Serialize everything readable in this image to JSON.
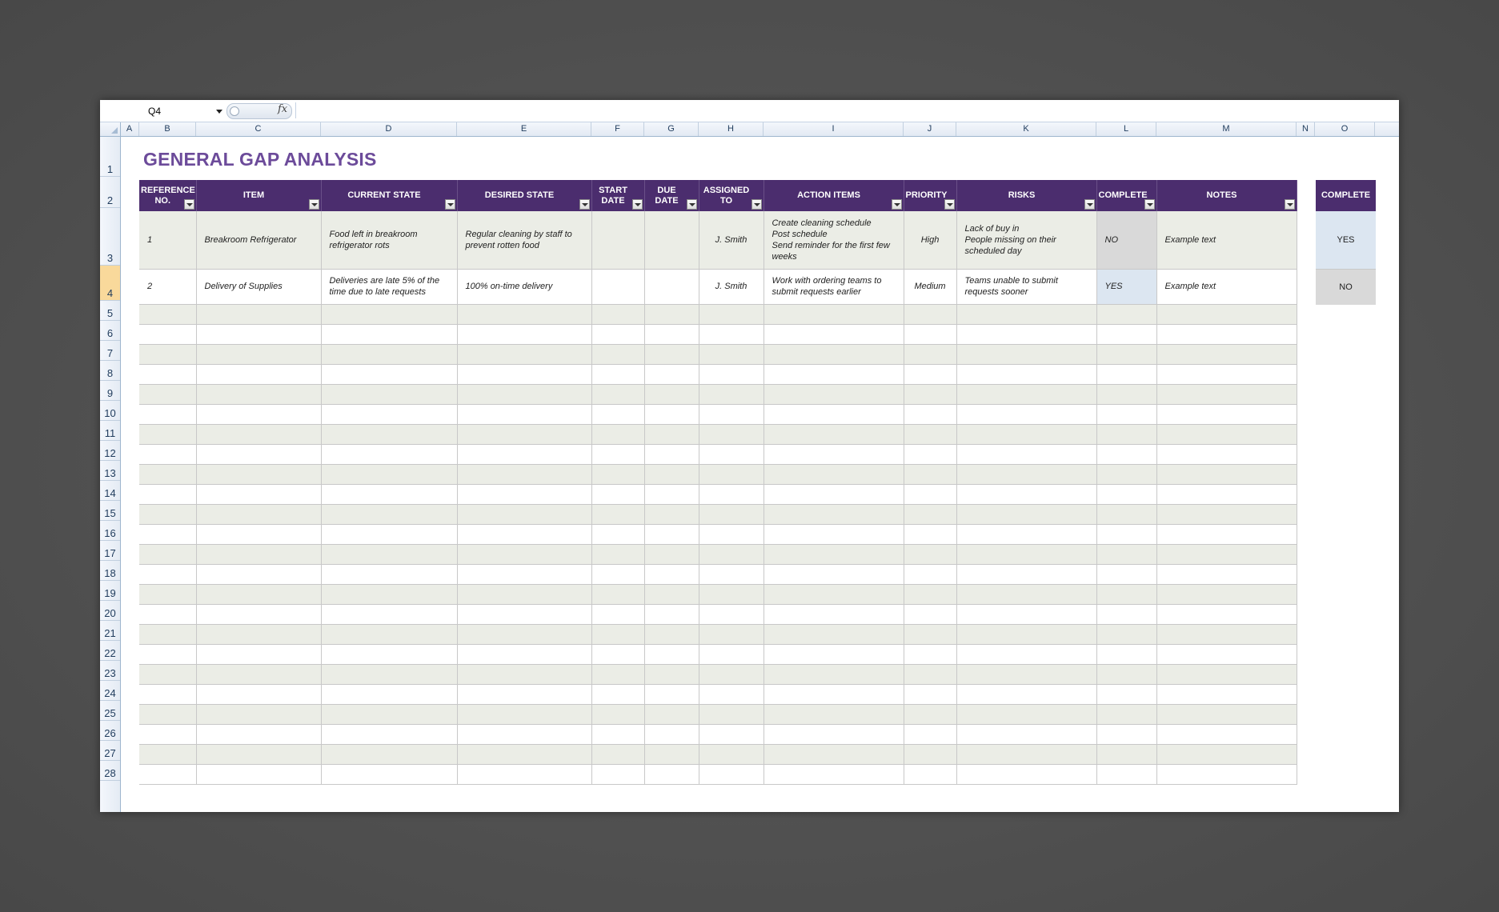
{
  "formula_bar": {
    "name_box": "Q4",
    "fx": "fx"
  },
  "columns": [
    "A",
    "B",
    "C",
    "D",
    "E",
    "F",
    "G",
    "H",
    "I",
    "J",
    "K",
    "L",
    "M",
    "N",
    "O"
  ],
  "rows": [
    "1",
    "2",
    "3",
    "4",
    "5",
    "6",
    "7",
    "8",
    "9",
    "10",
    "11",
    "12",
    "13",
    "14",
    "15",
    "16",
    "17",
    "18",
    "19",
    "20",
    "21",
    "22",
    "23",
    "24",
    "25",
    "26",
    "27",
    "28"
  ],
  "active_row": "4",
  "title": "GENERAL GAP ANALYSIS",
  "table": {
    "headers": [
      "REFERENCE\nNO.",
      "ITEM",
      "CURRENT STATE",
      "DESIRED STATE",
      "START\nDATE",
      "DUE\nDATE",
      "ASSIGNED\nTO",
      "ACTION ITEMS",
      "PRIORITY",
      "RISKS",
      "COMPLETE",
      "NOTES"
    ],
    "rows": [
      [
        "1",
        "Breakroom Refrigerator",
        "Food left in breakroom\nrefrigerator rots",
        "Regular cleaning by staff to\nprevent rotten food",
        "",
        "",
        "J. Smith",
        "Create cleaning schedule\nPost schedule\nSend reminder for the first few\nweeks",
        "High",
        "Lack of buy in\nPeople missing on their\nscheduled day",
        "NO",
        "Example text"
      ],
      [
        "2",
        "Delivery of Supplies",
        "Deliveries are late 5% of the\ntime due to late requests",
        "100% on-time delivery",
        "",
        "",
        "J. Smith",
        "Work with ordering teams to\nsubmit requests earlier",
        "Medium",
        "Teams unable to submit\nrequests sooner",
        "YES",
        "Example text"
      ]
    ],
    "empty_row_count": 24
  },
  "legend": {
    "header": "COMPLETE",
    "yes": "YES",
    "no": "NO"
  },
  "colors": {
    "header_purple": "#4b2d6e",
    "title_purple": "#6c4b9a",
    "band": "#ebede6",
    "yes_fill": "#dce6f1",
    "no_fill": "#d9d9d9"
  }
}
